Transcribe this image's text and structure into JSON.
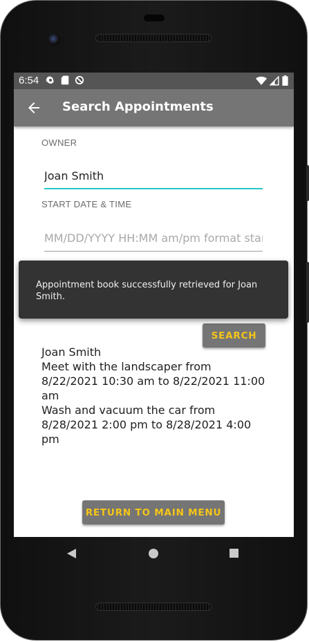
{
  "status_bar": {
    "time": "6:54",
    "left_icons": [
      "settings-icon",
      "sd-card-icon",
      "data-saver-icon"
    ],
    "right_icons": [
      "wifi-icon",
      "signal-icon",
      "battery-icon"
    ]
  },
  "app_bar": {
    "back_icon": "arrow-back-icon",
    "title": "Search Appointments"
  },
  "form": {
    "owner_label": "OWNER",
    "owner_value": "Joan Smith",
    "start_label": "START DATE & TIME",
    "start_value": "",
    "start_placeholder": "MM/DD/YYYY HH:MM am/pm format start"
  },
  "toast": {
    "message": "Appointment book successfully retrieved for Joan Smith."
  },
  "search_button": "SEARCH",
  "results": {
    "lines": [
      "Joan Smith",
      "Meet with the landscaper from 8/22/2021 10:30 am to 8/22/2021 11:00 am",
      "Wash and vacuum the car from 8/28/2021 2:00 pm to 8/28/2021 4:00 pm"
    ]
  },
  "return_button": "RETURN TO MAIN MENU",
  "nav_bar": {
    "icons": [
      "nav-back-icon",
      "nav-home-icon",
      "nav-recents-icon"
    ]
  },
  "colors": {
    "app_bar": "#757575",
    "status_bar": "#555555",
    "accent": "#26c6c9",
    "button_text": "#f5c518",
    "toast_bg": "#333333"
  }
}
